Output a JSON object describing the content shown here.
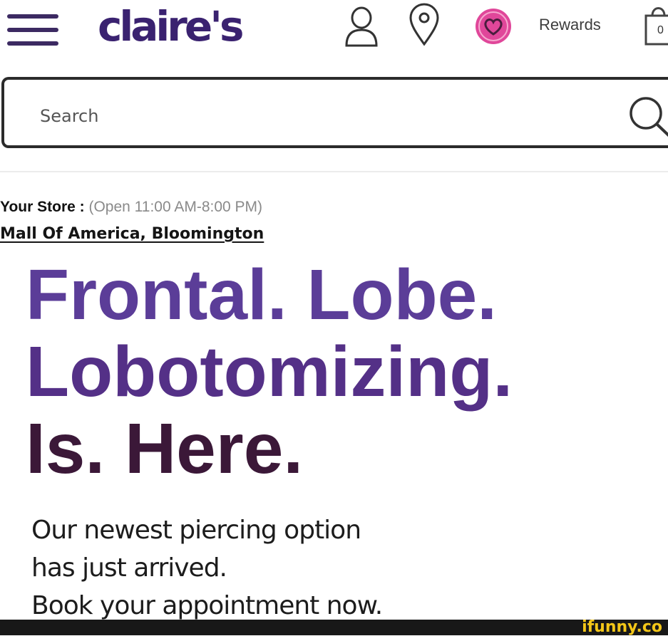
{
  "header": {
    "logo": "claire's",
    "rewards_label": "Rewards",
    "bag_count": "0",
    "icons": [
      "menu-icon",
      "account-icon",
      "store-locator-icon",
      "rewards-heart-icon",
      "shopping-bag-icon"
    ],
    "brand_color": "#3a2270",
    "rewards_color": "#e0479a"
  },
  "search": {
    "placeholder": "Search"
  },
  "store": {
    "label": "Your Store :",
    "hours": "(Open 11:00 AM-8:00 PM)",
    "location": "Mall Of America, Bloomington"
  },
  "promo": {
    "headline_lines": [
      "Frontal. Lobe.",
      "Lobotomizing.",
      "Is. Here."
    ],
    "body_lines": [
      "Our newest piercing option",
      "has just arrived.",
      "Book your appointment now."
    ]
  },
  "watermark": "ifunny.co"
}
